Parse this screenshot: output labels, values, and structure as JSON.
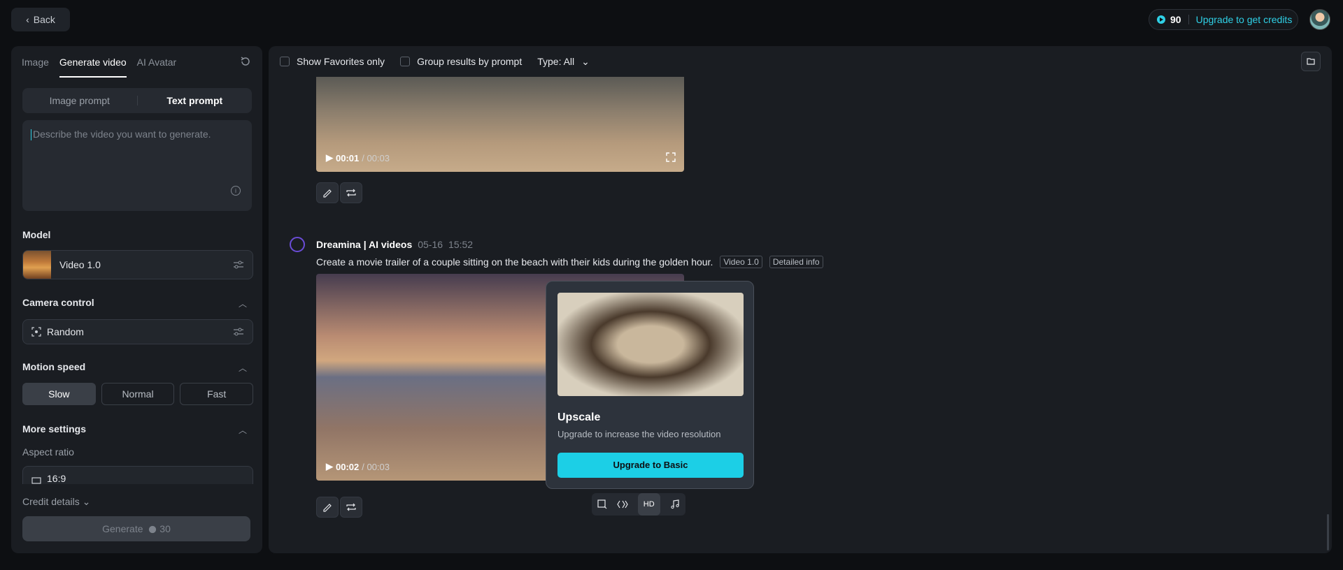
{
  "topbar": {
    "back_label": "Back",
    "credits": "90",
    "upgrade_label": "Upgrade to get credits"
  },
  "left": {
    "tabs": [
      "Image",
      "Generate video",
      "AI Avatar"
    ],
    "prompt_modes": [
      "Image prompt",
      "Text prompt"
    ],
    "prompt_placeholder": "Describe the video you want to generate.",
    "model_label": "Model",
    "model_value": "Video 1.0",
    "camera_label": "Camera control",
    "camera_value": "Random",
    "motion_label": "Motion speed",
    "motion_options": [
      "Slow",
      "Normal",
      "Fast"
    ],
    "more_label": "More settings",
    "aspect_label": "Aspect ratio",
    "aspect_value": "16:9",
    "credit_details": "Credit details",
    "generate_label": "Generate",
    "generate_cost": "30"
  },
  "filters": {
    "favorites": "Show Favorites only",
    "group": "Group results by prompt",
    "type": "Type: All"
  },
  "video1": {
    "current": "00:01",
    "total": "/ 00:03"
  },
  "gen2": {
    "name": "Dreamina | AI videos",
    "date": "05-16",
    "time": "15:52",
    "prompt": "Create a movie trailer of a couple sitting on the beach with their kids during the golden hour.",
    "tag_model": "Video 1.0",
    "tag_info": "Detailed info",
    "current": "00:02",
    "total": "/ 00:03"
  },
  "upscale": {
    "title": "Upscale",
    "desc": "Upgrade to increase the video resolution",
    "cta": "Upgrade to Basic"
  },
  "toolbar": {
    "hd": "HD"
  },
  "colors": {
    "accent": "#1ccfe6",
    "panel": "#1a1d22",
    "bg": "#0d0f12"
  }
}
